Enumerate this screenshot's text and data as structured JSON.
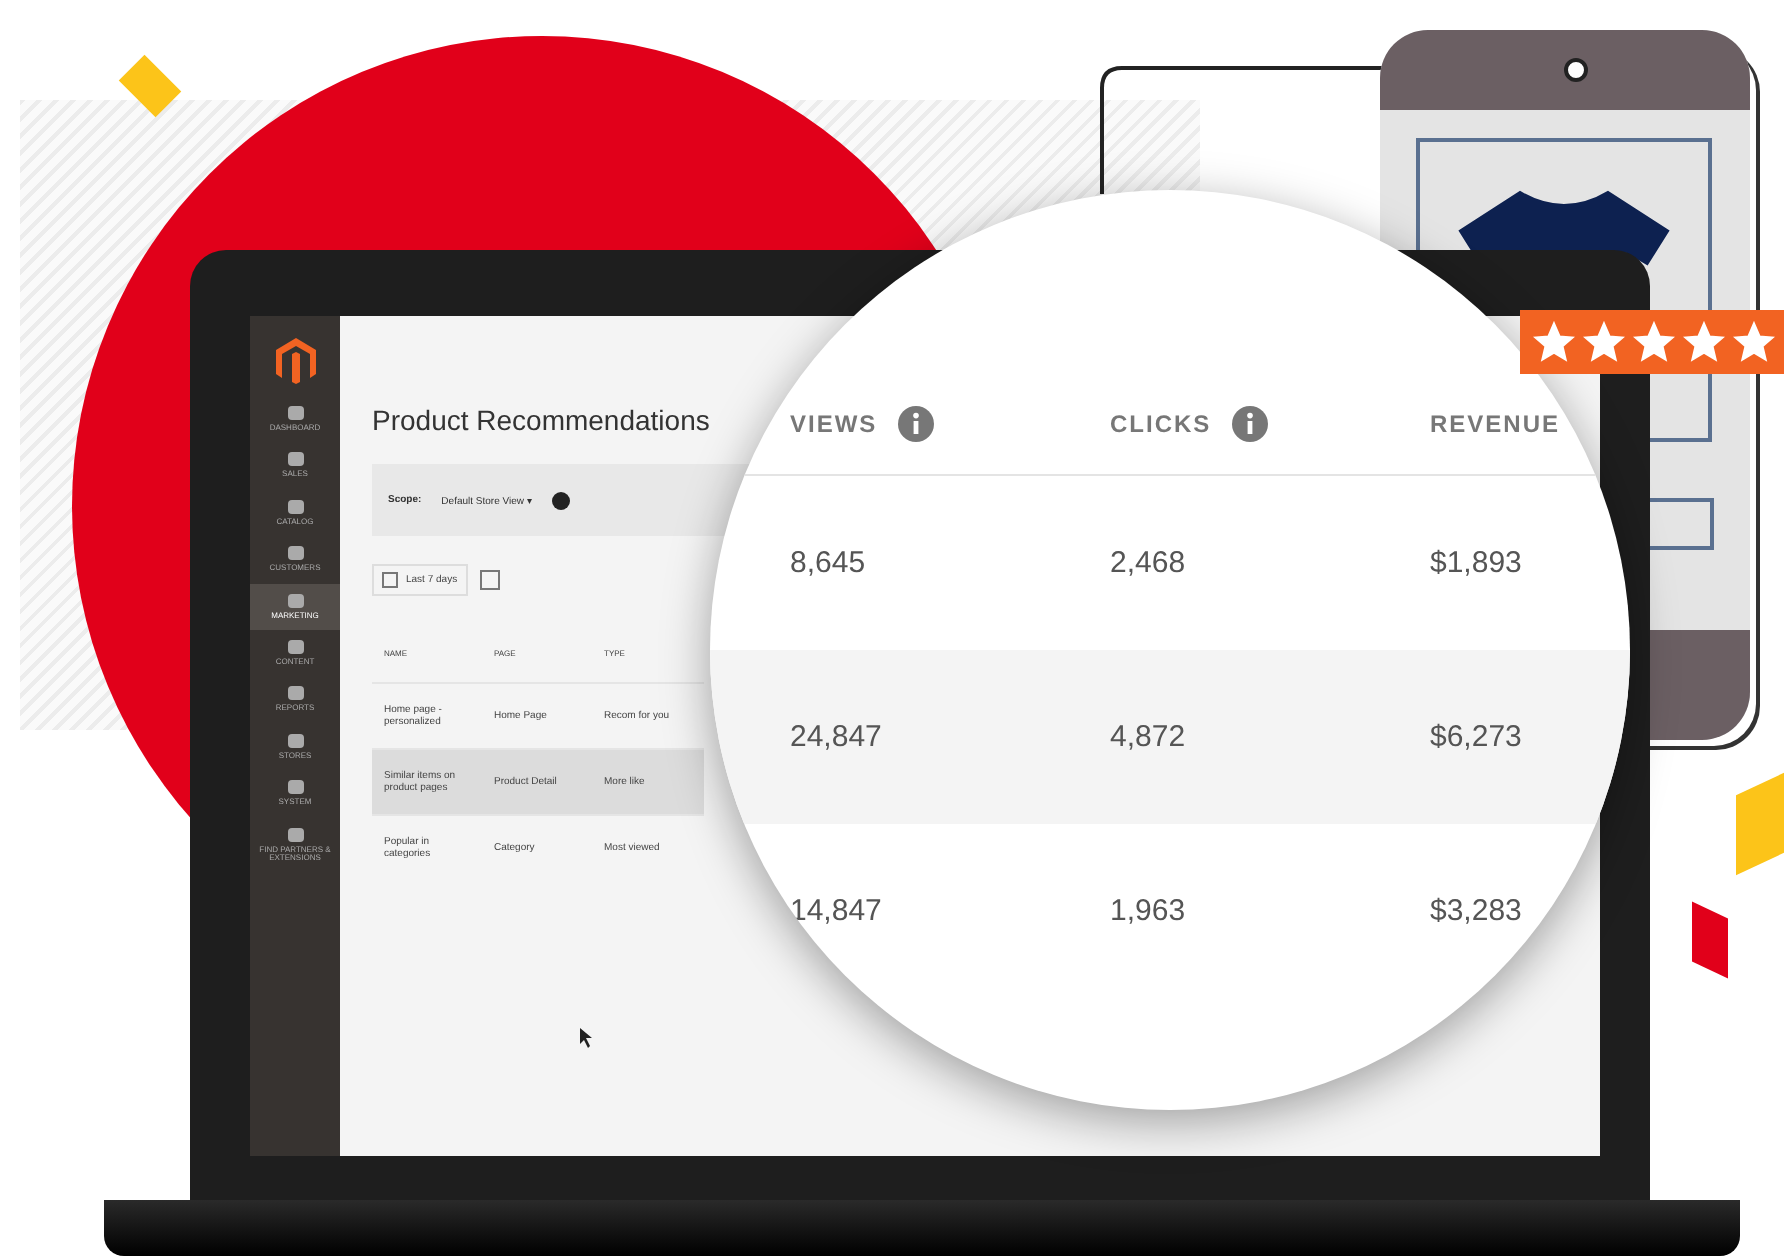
{
  "sidebar": {
    "items": [
      {
        "label": "DASHBOARD",
        "selected": false
      },
      {
        "label": "SALES",
        "selected": false
      },
      {
        "label": "CATALOG",
        "selected": false
      },
      {
        "label": "CUSTOMERS",
        "selected": false
      },
      {
        "label": "MARKETING",
        "selected": true
      },
      {
        "label": "CONTENT",
        "selected": false
      },
      {
        "label": "REPORTS",
        "selected": false
      },
      {
        "label": "STORES",
        "selected": false
      },
      {
        "label": "SYSTEM",
        "selected": false
      },
      {
        "label": "FIND PARTNERS & EXTENSIONS",
        "selected": false
      }
    ]
  },
  "page_title": "Product Recommendations",
  "scope": {
    "label": "Scope:",
    "value": "Default Store View",
    "caret": "▾"
  },
  "date_range": "Last 7 days",
  "table": {
    "columns": [
      "NAME",
      "PAGE",
      "TYPE"
    ],
    "rows": [
      {
        "cells": [
          "Home page - personalized",
          "Home Page",
          "Recom for you"
        ],
        "selected": false
      },
      {
        "cells": [
          "Similar items on product pages",
          "Product Detail",
          "More like"
        ],
        "selected": true
      },
      {
        "cells": [
          "Popular in categories",
          "Category",
          "Most viewed"
        ],
        "selected": false
      }
    ]
  },
  "lens": {
    "columns": [
      {
        "label": "VIEWS",
        "info": true
      },
      {
        "label": "CLICKS",
        "info": true
      },
      {
        "label": "REVENUE",
        "info": false
      }
    ],
    "rows": [
      [
        "8,645",
        "2,468",
        "$1,893"
      ],
      [
        "24,847",
        "4,872",
        "$6,273"
      ],
      [
        "14,847",
        "1,963",
        "$3,283"
      ]
    ]
  },
  "rating": {
    "stars": 5
  }
}
